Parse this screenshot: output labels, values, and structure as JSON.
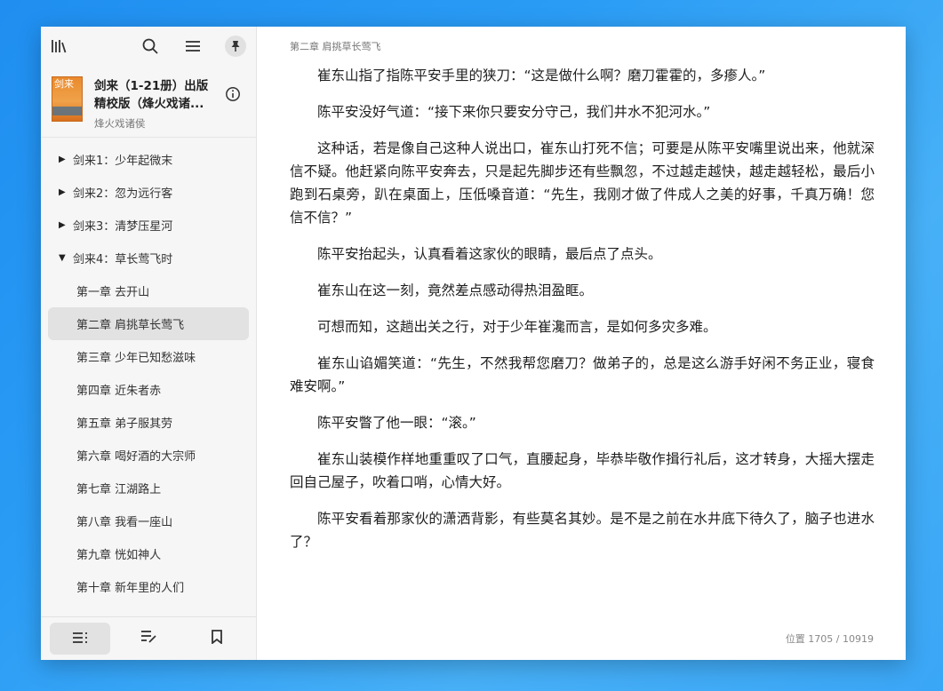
{
  "sidebar": {
    "book": {
      "cover_text": "剑来",
      "title_line1": "剑来（1-21册）出版",
      "title_line2": "精校版（烽火戏诸...",
      "author": "烽火戏诸侯"
    },
    "toc": [
      {
        "type": "vol",
        "expanded": false,
        "label": "剑来1：少年起微末"
      },
      {
        "type": "vol",
        "expanded": false,
        "label": "剑来2：忽为远行客"
      },
      {
        "type": "vol",
        "expanded": false,
        "label": "剑来3：清梦压星河"
      },
      {
        "type": "vol",
        "expanded": true,
        "label": "剑来4：草长莺飞时"
      },
      {
        "type": "ch",
        "label": "第一章 去开山"
      },
      {
        "type": "ch",
        "label": "第二章 肩挑草长莺飞",
        "active": true
      },
      {
        "type": "ch",
        "label": "第三章 少年已知愁滋味"
      },
      {
        "type": "ch",
        "label": "第四章 近朱者赤"
      },
      {
        "type": "ch",
        "label": "第五章 弟子服其劳"
      },
      {
        "type": "ch",
        "label": "第六章 喝好酒的大宗师"
      },
      {
        "type": "ch",
        "label": "第七章 江湖路上"
      },
      {
        "type": "ch",
        "label": "第八章 我看一座山"
      },
      {
        "type": "ch",
        "label": "第九章 恍如神人"
      },
      {
        "type": "ch",
        "label": "第十章 新年里的人们"
      }
    ],
    "bottom_tabs": [
      {
        "icon": "contents-list-icon",
        "active": true
      },
      {
        "icon": "annotations-icon",
        "active": false
      },
      {
        "icon": "bookmark-icon",
        "active": false
      }
    ]
  },
  "reader": {
    "chapter_header": "第二章 肩挑草长莺飞",
    "paragraphs": [
      "崔东山指了指陈平安手里的狭刀：“这是做什么啊？磨刀霍霍的，多瘆人。”",
      "陈平安没好气道：“接下来你只要安分守己，我们井水不犯河水。”",
      "这种话，若是像自己这种人说出口，崔东山打死不信；可要是从陈平安嘴里说出来，他就深信不疑。他赶紧向陈平安奔去，只是起先脚步还有些飘忽，不过越走越快，越走越轻松，最后小跑到石桌旁，趴在桌面上，压低嗓音道：“先生，我刚才做了件成人之美的好事，千真万确！您信不信？”",
      "陈平安抬起头，认真看着这家伙的眼睛，最后点了点头。",
      "崔东山在这一刻，竟然差点感动得热泪盈眶。",
      "可想而知，这趟出关之行，对于少年崔瀺而言，是如何多灾多难。",
      "崔东山谄媚笑道：“先生，不然我帮您磨刀？做弟子的，总是这么游手好闲不务正业，寝食难安啊。”",
      "陈平安瞥了他一眼：“滚。”",
      "崔东山装模作样地重重叹了口气，直腰起身，毕恭毕敬作揖行礼后，这才转身，大摇大摆走回自己屋子，吹着口哨，心情大好。",
      "陈平安看着那家伙的潇洒背影，有些莫名其妙。是不是之前在水井底下待久了，脑子也进水了？"
    ],
    "location": "位置 1705 / 10919"
  }
}
